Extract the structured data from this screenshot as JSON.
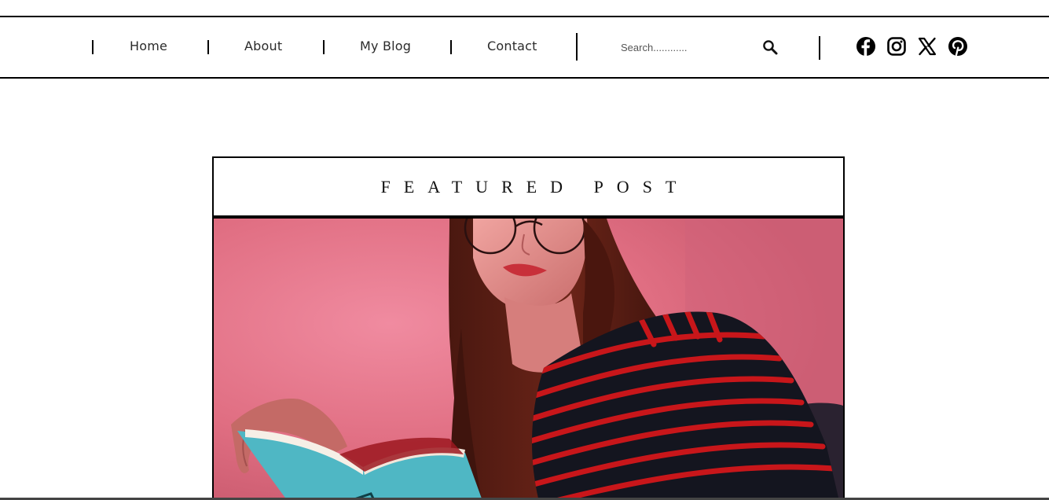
{
  "nav": {
    "links": [
      {
        "label": "Home"
      },
      {
        "label": "About"
      },
      {
        "label": "My Blog"
      },
      {
        "label": "Contact"
      }
    ],
    "search": {
      "placeholder": "Search............"
    },
    "social": [
      "facebook-icon",
      "instagram-icon",
      "x-icon",
      "pinterest-icon"
    ]
  },
  "featured": {
    "heading": "FEATURED POST"
  },
  "colors": {
    "border": "#000000",
    "background": "#ffffff",
    "wall_pink": "#e46f80",
    "stripe_red": "#c8161a",
    "shirt_navy": "#14151f",
    "book_teal": "#4fb7c4"
  }
}
